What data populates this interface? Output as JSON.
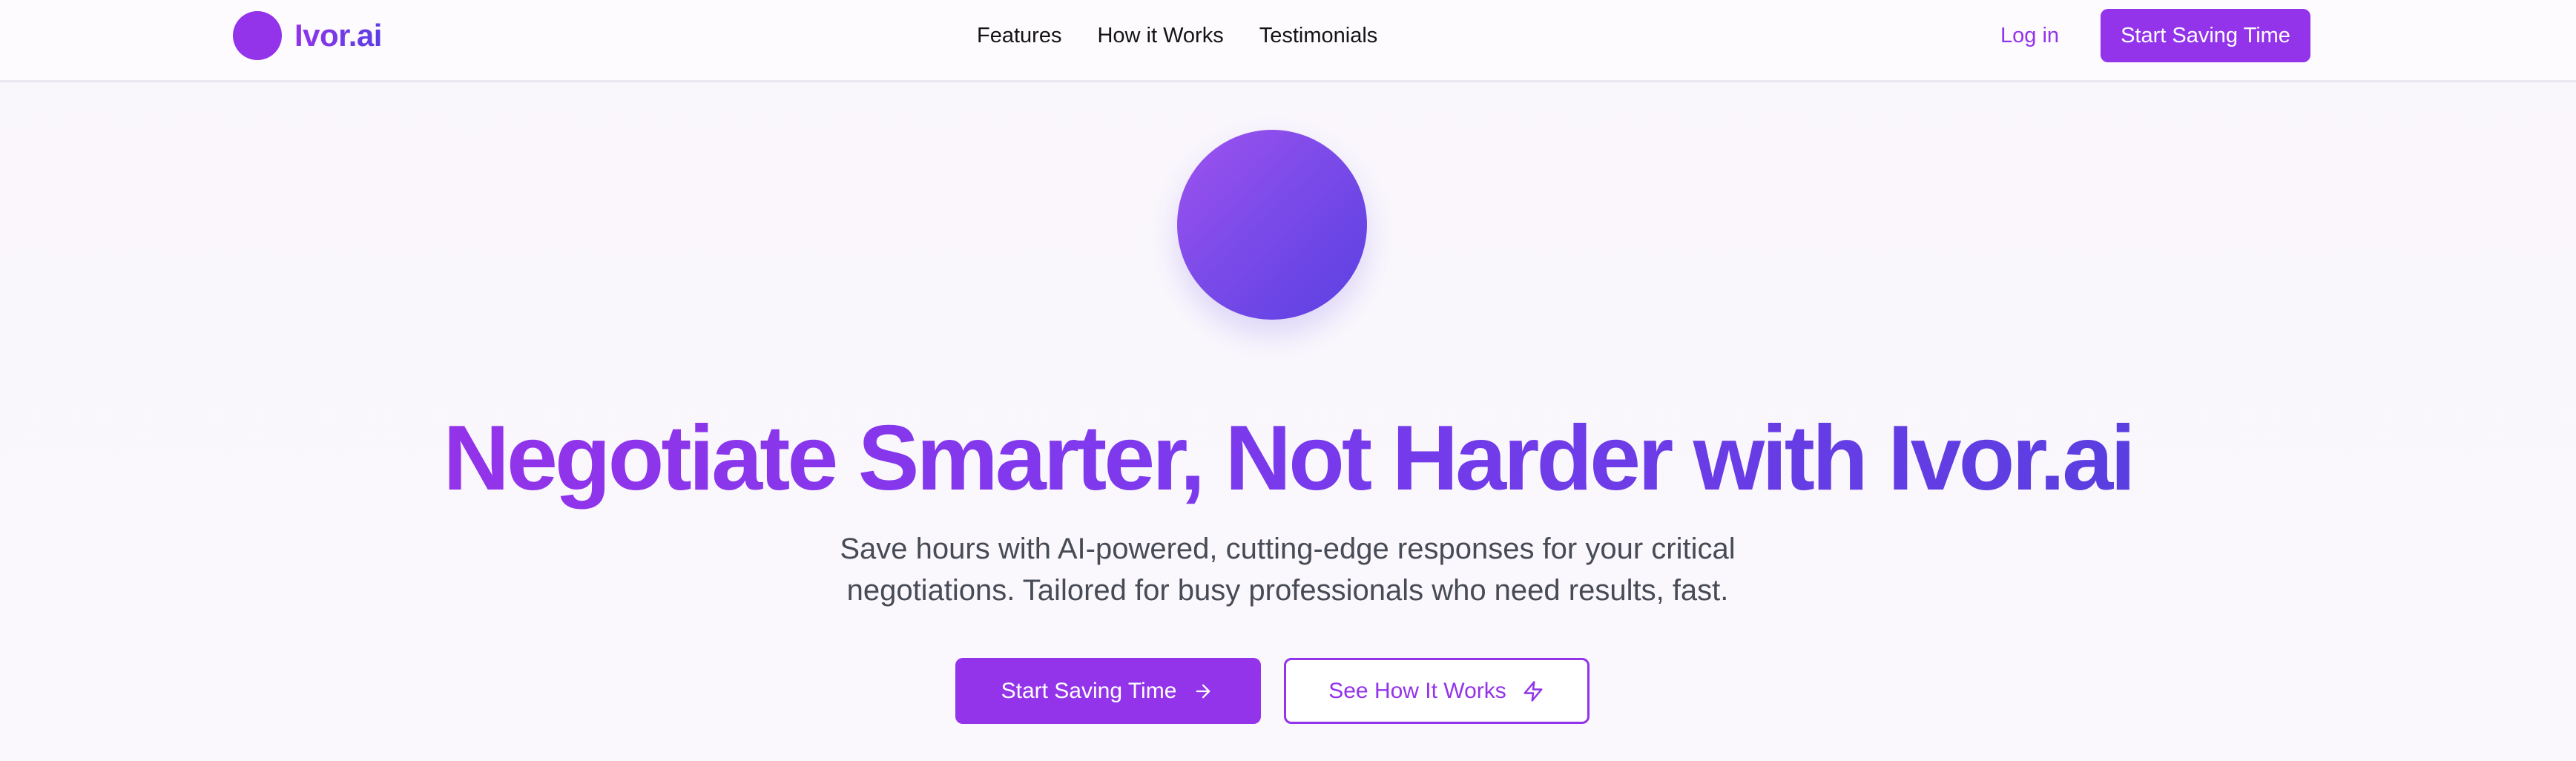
{
  "brand": {
    "name": "Ivor.ai",
    "accent_color": "#9333ea",
    "secondary_color": "#5b3fe2"
  },
  "nav": {
    "links": [
      "Features",
      "How it Works",
      "Testimonials"
    ],
    "login_label": "Log in",
    "cta_label": "Start Saving Time"
  },
  "hero": {
    "title": "Negotiate Smarter, Not Harder with Ivor.ai",
    "subtitle": "Save hours with AI-powered, cutting-edge responses for your critical negotiations. Tailored for busy professionals who need results, fast.",
    "primary_cta": {
      "label": "Start Saving Time",
      "icon": "arrow-right-icon"
    },
    "secondary_cta": {
      "label": "See How It Works",
      "icon": "lightning-icon"
    }
  }
}
